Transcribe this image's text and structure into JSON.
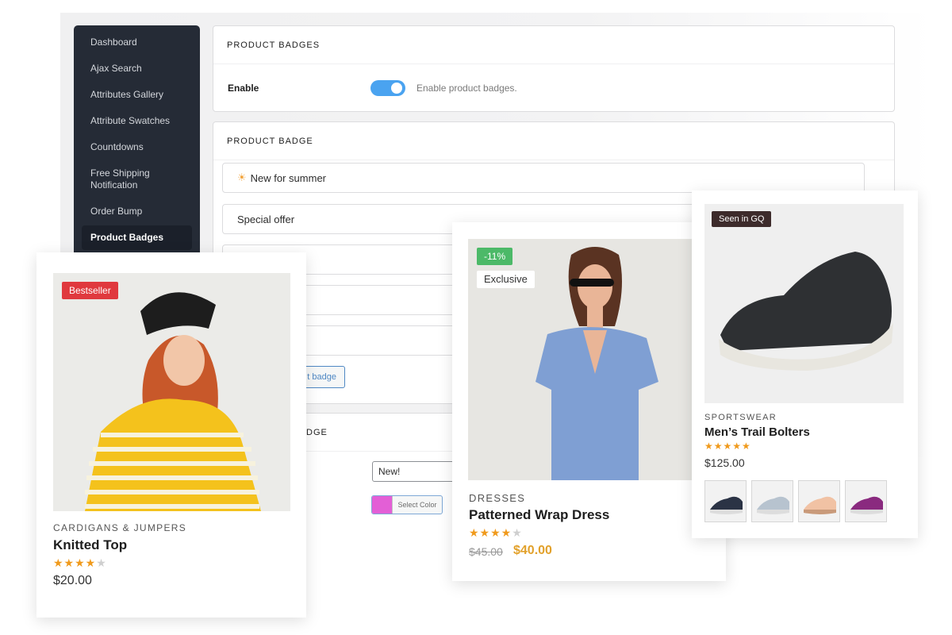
{
  "sidebar": {
    "items": [
      {
        "label": "Dashboard"
      },
      {
        "label": "Ajax Search"
      },
      {
        "label": "Attributes Gallery"
      },
      {
        "label": "Attribute Swatches"
      },
      {
        "label": "Countdowns"
      },
      {
        "label": "Free Shipping Notification"
      },
      {
        "label": "Order Bump"
      },
      {
        "label": "Product Badges",
        "active": true
      }
    ]
  },
  "settings": {
    "section_title": "PRODUCT BADGES",
    "enable_label": "Enable",
    "enable_on": true,
    "enable_description": "Enable product badges."
  },
  "badges_panel": {
    "section_title": "PRODUCT BADGE",
    "rows": [
      {
        "label": "New for summer",
        "icon": "sun-icon"
      },
      {
        "label": "Special offer"
      }
    ],
    "add_button_label": "t badge"
  },
  "badge_editor": {
    "section_title": "DGE",
    "text_value": "New!",
    "color": "#e35fd6",
    "color_button_label": "Select Color"
  },
  "products": [
    {
      "badge": "Bestseller",
      "badge_color": "#e0393e",
      "category": "CARDIGANS & JUMPERS",
      "name": "Knitted Top",
      "rating": 4,
      "rating_max": 5,
      "price": "$20.00"
    },
    {
      "badges": [
        "-11%",
        "Exclusive"
      ],
      "discount_color": "#4cb968",
      "category": "DRESSES",
      "name": "Patterned Wrap Dress",
      "rating": 4,
      "rating_max": 5,
      "old_price": "$45.00",
      "price": "$40.00",
      "price_color": "#e2a12b"
    },
    {
      "badge": "Seen in GQ",
      "badge_color": "#3d2b2b",
      "category": "SPORTSWEAR",
      "name": "Men’s Trail Bolters",
      "rating": 5,
      "rating_max": 5,
      "price": "$125.00",
      "variants": [
        "navy",
        "light-grey",
        "peach",
        "purple"
      ]
    }
  ]
}
